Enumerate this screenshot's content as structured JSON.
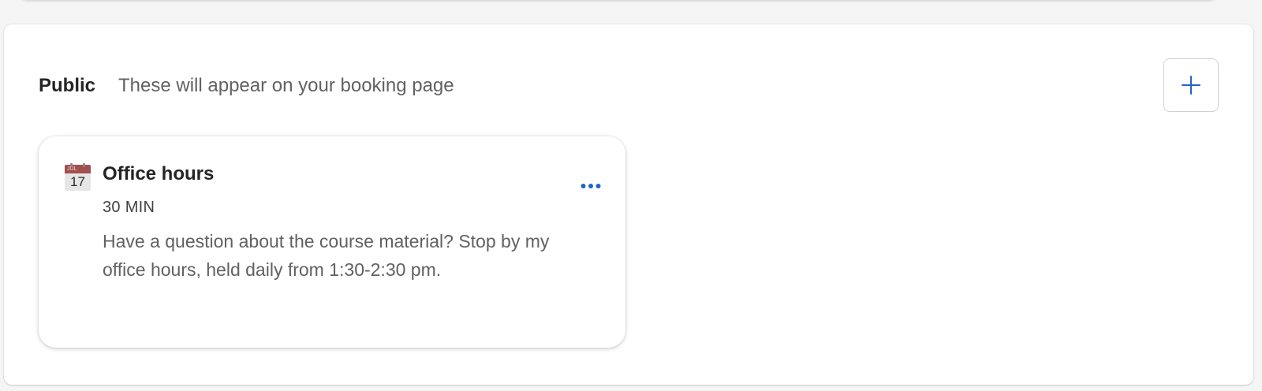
{
  "section": {
    "title": "Public",
    "subtitle": "These will appear on your booking page",
    "add_icon": "plus-icon"
  },
  "card": {
    "icon": "calendar-icon",
    "icon_month": "JUL",
    "icon_day": "17",
    "title": "Office hours",
    "duration": "30 MIN",
    "description": "Have a question about the course material? Stop by my office hours, held daily from 1:30-2:30 pm.",
    "more_icon": "more-horizontal-icon"
  },
  "colors": {
    "accent": "#2266c2",
    "title_text": "#242424",
    "secondary_text": "#616161"
  }
}
